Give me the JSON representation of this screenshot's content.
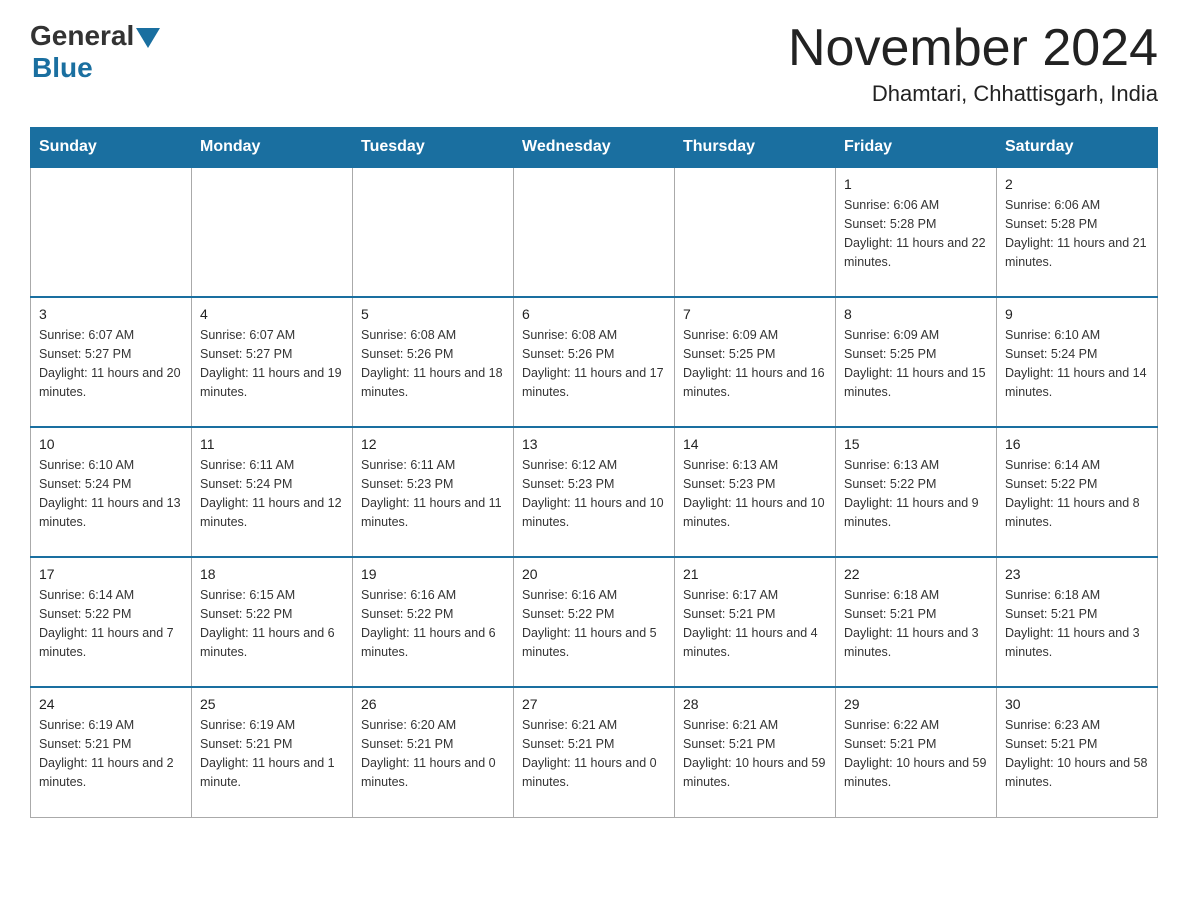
{
  "header": {
    "logo_general": "General",
    "logo_blue": "Blue",
    "title": "November 2024",
    "subtitle": "Dhamtari, Chhattisgarh, India"
  },
  "calendar": {
    "days_of_week": [
      "Sunday",
      "Monday",
      "Tuesday",
      "Wednesday",
      "Thursday",
      "Friday",
      "Saturday"
    ],
    "weeks": [
      [
        {
          "day": "",
          "info": ""
        },
        {
          "day": "",
          "info": ""
        },
        {
          "day": "",
          "info": ""
        },
        {
          "day": "",
          "info": ""
        },
        {
          "day": "",
          "info": ""
        },
        {
          "day": "1",
          "info": "Sunrise: 6:06 AM\nSunset: 5:28 PM\nDaylight: 11 hours and 22 minutes."
        },
        {
          "day": "2",
          "info": "Sunrise: 6:06 AM\nSunset: 5:28 PM\nDaylight: 11 hours and 21 minutes."
        }
      ],
      [
        {
          "day": "3",
          "info": "Sunrise: 6:07 AM\nSunset: 5:27 PM\nDaylight: 11 hours and 20 minutes."
        },
        {
          "day": "4",
          "info": "Sunrise: 6:07 AM\nSunset: 5:27 PM\nDaylight: 11 hours and 19 minutes."
        },
        {
          "day": "5",
          "info": "Sunrise: 6:08 AM\nSunset: 5:26 PM\nDaylight: 11 hours and 18 minutes."
        },
        {
          "day": "6",
          "info": "Sunrise: 6:08 AM\nSunset: 5:26 PM\nDaylight: 11 hours and 17 minutes."
        },
        {
          "day": "7",
          "info": "Sunrise: 6:09 AM\nSunset: 5:25 PM\nDaylight: 11 hours and 16 minutes."
        },
        {
          "day": "8",
          "info": "Sunrise: 6:09 AM\nSunset: 5:25 PM\nDaylight: 11 hours and 15 minutes."
        },
        {
          "day": "9",
          "info": "Sunrise: 6:10 AM\nSunset: 5:24 PM\nDaylight: 11 hours and 14 minutes."
        }
      ],
      [
        {
          "day": "10",
          "info": "Sunrise: 6:10 AM\nSunset: 5:24 PM\nDaylight: 11 hours and 13 minutes."
        },
        {
          "day": "11",
          "info": "Sunrise: 6:11 AM\nSunset: 5:24 PM\nDaylight: 11 hours and 12 minutes."
        },
        {
          "day": "12",
          "info": "Sunrise: 6:11 AM\nSunset: 5:23 PM\nDaylight: 11 hours and 11 minutes."
        },
        {
          "day": "13",
          "info": "Sunrise: 6:12 AM\nSunset: 5:23 PM\nDaylight: 11 hours and 10 minutes."
        },
        {
          "day": "14",
          "info": "Sunrise: 6:13 AM\nSunset: 5:23 PM\nDaylight: 11 hours and 10 minutes."
        },
        {
          "day": "15",
          "info": "Sunrise: 6:13 AM\nSunset: 5:22 PM\nDaylight: 11 hours and 9 minutes."
        },
        {
          "day": "16",
          "info": "Sunrise: 6:14 AM\nSunset: 5:22 PM\nDaylight: 11 hours and 8 minutes."
        }
      ],
      [
        {
          "day": "17",
          "info": "Sunrise: 6:14 AM\nSunset: 5:22 PM\nDaylight: 11 hours and 7 minutes."
        },
        {
          "day": "18",
          "info": "Sunrise: 6:15 AM\nSunset: 5:22 PM\nDaylight: 11 hours and 6 minutes."
        },
        {
          "day": "19",
          "info": "Sunrise: 6:16 AM\nSunset: 5:22 PM\nDaylight: 11 hours and 6 minutes."
        },
        {
          "day": "20",
          "info": "Sunrise: 6:16 AM\nSunset: 5:22 PM\nDaylight: 11 hours and 5 minutes."
        },
        {
          "day": "21",
          "info": "Sunrise: 6:17 AM\nSunset: 5:21 PM\nDaylight: 11 hours and 4 minutes."
        },
        {
          "day": "22",
          "info": "Sunrise: 6:18 AM\nSunset: 5:21 PM\nDaylight: 11 hours and 3 minutes."
        },
        {
          "day": "23",
          "info": "Sunrise: 6:18 AM\nSunset: 5:21 PM\nDaylight: 11 hours and 3 minutes."
        }
      ],
      [
        {
          "day": "24",
          "info": "Sunrise: 6:19 AM\nSunset: 5:21 PM\nDaylight: 11 hours and 2 minutes."
        },
        {
          "day": "25",
          "info": "Sunrise: 6:19 AM\nSunset: 5:21 PM\nDaylight: 11 hours and 1 minute."
        },
        {
          "day": "26",
          "info": "Sunrise: 6:20 AM\nSunset: 5:21 PM\nDaylight: 11 hours and 0 minutes."
        },
        {
          "day": "27",
          "info": "Sunrise: 6:21 AM\nSunset: 5:21 PM\nDaylight: 11 hours and 0 minutes."
        },
        {
          "day": "28",
          "info": "Sunrise: 6:21 AM\nSunset: 5:21 PM\nDaylight: 10 hours and 59 minutes."
        },
        {
          "day": "29",
          "info": "Sunrise: 6:22 AM\nSunset: 5:21 PM\nDaylight: 10 hours and 59 minutes."
        },
        {
          "day": "30",
          "info": "Sunrise: 6:23 AM\nSunset: 5:21 PM\nDaylight: 10 hours and 58 minutes."
        }
      ]
    ]
  }
}
